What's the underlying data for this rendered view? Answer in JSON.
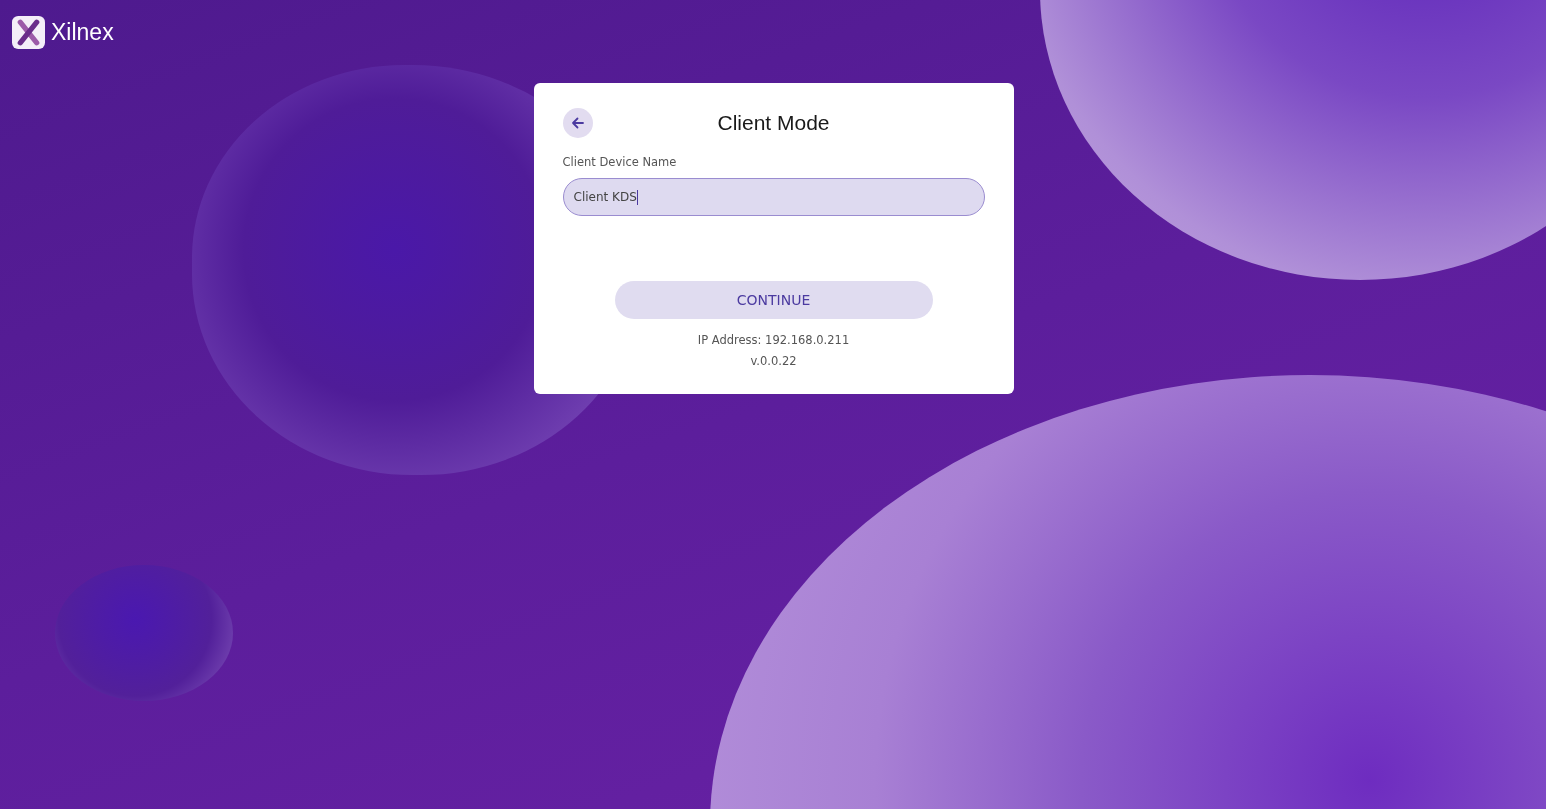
{
  "brand": {
    "name": "Xilnex"
  },
  "dialog": {
    "title": "Client Mode",
    "field": {
      "label": "Client Device Name",
      "value": "Client KDS",
      "focused": true
    },
    "button": "CONTINUE",
    "ip_address": "IP Address: 192.168.0.211",
    "version": "v.0.0.22"
  }
}
